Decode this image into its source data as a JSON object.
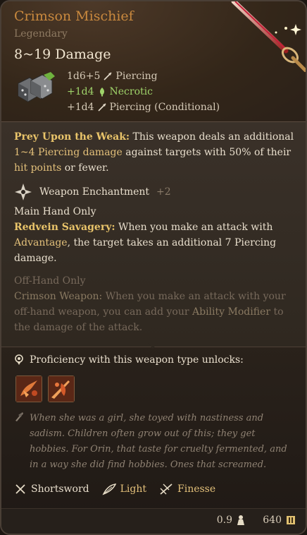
{
  "item": {
    "name": "Crimson Mischief",
    "rarity": "Legendary",
    "damage": "8~19 Damage",
    "damage_rows": [
      {
        "dice": "1d6+5",
        "type": "Piercing",
        "style": "normal",
        "icon": "piercing-icon"
      },
      {
        "dice": "+1d4",
        "type": "Necrotic",
        "style": "green",
        "icon": "necrotic-icon"
      },
      {
        "dice": "+1d4",
        "type": "Piercing (Conditional)",
        "style": "normal",
        "icon": "piercing-icon"
      }
    ]
  },
  "passive": {
    "title": "Prey Upon the Weak:",
    "text_a": " This weapon deals an additional ",
    "highlight_a": "1~4 Piercing damage",
    "text_b": " against targets with 50% of their ",
    "highlight_b": "hit points",
    "text_c": " or fewer."
  },
  "enchantment": {
    "label": "Weapon Enchantment",
    "value": "+2"
  },
  "main_hand": {
    "heading": "Main Hand Only",
    "title": "Redvein Savagery:",
    "text_a": " When you make an attack with ",
    "highlight": "Advantage",
    "text_b": ", the target takes an additional 7 Piercing damage."
  },
  "off_hand": {
    "heading": "Off-Hand Only",
    "title": "Crimson Weapon:",
    "text_a": " When you make an attack with your off-hand weapon, you can add your ",
    "highlight": "Ability Modifier",
    "text_b": " to the damage of the attack."
  },
  "proficiency": {
    "label": "Proficiency with this weapon type unlocks:"
  },
  "lore": "When she was a girl, she toyed with nastiness and sadism. Children often grow out of this; they get hobbies. For Orin, that taste for cruelty fermented, and in a way she did find hobbies. Ones that screamed.",
  "properties": [
    {
      "label": "Shortsword",
      "style": "normal",
      "icon": "shortsword-icon"
    },
    {
      "label": "Light",
      "style": "gold",
      "icon": "feather-icon"
    },
    {
      "label": "Finesse",
      "style": "gold",
      "icon": "finesse-icon"
    }
  ],
  "footer": {
    "weight": "0.9",
    "price": "640"
  },
  "colors": {
    "title": "#c9893e",
    "highlight": "#e9c46a",
    "necrotic": "#9fd36a"
  }
}
